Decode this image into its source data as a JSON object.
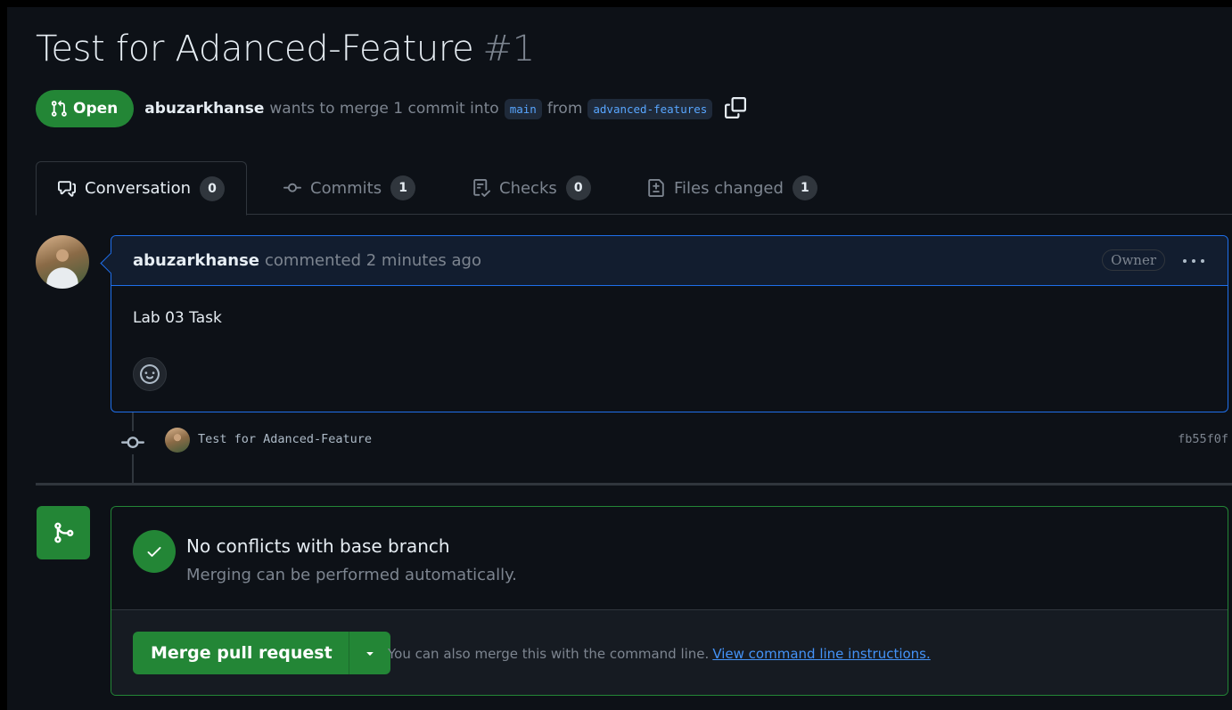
{
  "pr": {
    "title": "Test for Adanced-Feature",
    "number": "#1",
    "state": "Open",
    "author": "abuzarkhanse",
    "merge_text": "wants to merge 1 commit into",
    "base_branch": "main",
    "from_text": "from",
    "head_branch": "advanced-features"
  },
  "tabs": [
    {
      "label": "Conversation",
      "count": "0",
      "icon": "comment-discussion-icon"
    },
    {
      "label": "Commits",
      "count": "1",
      "icon": "git-commit-icon"
    },
    {
      "label": "Checks",
      "count": "0",
      "icon": "checklist-icon"
    },
    {
      "label": "Files changed",
      "count": "1",
      "icon": "file-diff-icon"
    }
  ],
  "comment": {
    "author": "abuzarkhanse",
    "action": "commented 2 minutes ago",
    "badge": "Owner",
    "body": "Lab 03 Task"
  },
  "timeline": {
    "commit_message": "Test for Adanced-Feature",
    "commit_sha": "fb55f0f"
  },
  "merge": {
    "heading": "No conflicts with base branch",
    "subtext": "Merging can be performed automatically.",
    "button_label": "Merge pull request",
    "hint_text": "You can also merge this with the command line.",
    "hint_link": "View command line instructions."
  },
  "colors": {
    "background": "#0d1117",
    "success": "#238636",
    "accent": "#1f6feb",
    "link": "#4493f8",
    "muted": "#7d8590"
  }
}
